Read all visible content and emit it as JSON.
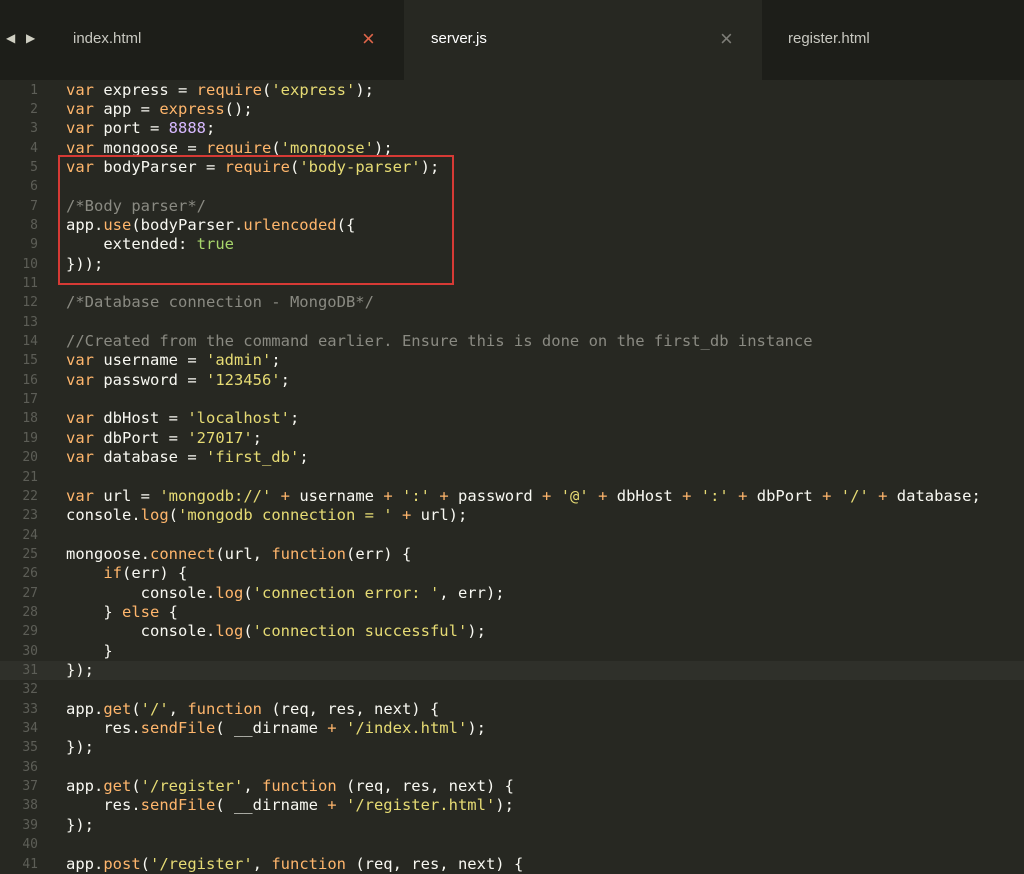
{
  "tabs": [
    {
      "label": "index.html",
      "close_icon": "×",
      "active": false
    },
    {
      "label": "server.js",
      "close_icon": "×",
      "active": true
    },
    {
      "label": "register.html",
      "active": false
    }
  ],
  "nav": {
    "back": "◀",
    "forward": "▶"
  },
  "colors": {
    "keyword": "#ffb66c",
    "string": "#e6db74",
    "comment": "#8a8a82",
    "number": "#d7b9ff",
    "highlight_box": "#d63a35"
  },
  "editor": {
    "current_line": 31,
    "lines": [
      [
        [
          "kw",
          "var"
        ],
        [
          "p",
          " express = "
        ],
        [
          "kw",
          "require"
        ],
        [
          "p",
          "("
        ],
        [
          "st",
          "'express'"
        ],
        [
          "p",
          ");"
        ]
      ],
      [
        [
          "kw",
          "var"
        ],
        [
          "p",
          " app = "
        ],
        [
          "kw",
          "express"
        ],
        [
          "p",
          "();"
        ]
      ],
      [
        [
          "kw",
          "var"
        ],
        [
          "p",
          " port = "
        ],
        [
          "nu",
          "8888"
        ],
        [
          "p",
          ";"
        ]
      ],
      [
        [
          "kw",
          "var"
        ],
        [
          "p",
          " mongoose = "
        ],
        [
          "kw",
          "require"
        ],
        [
          "p",
          "("
        ],
        [
          "st",
          "'mongoose'"
        ],
        [
          "p",
          ");"
        ]
      ],
      [
        [
          "kw",
          "var"
        ],
        [
          "p",
          " bodyParser = "
        ],
        [
          "kw",
          "require"
        ],
        [
          "p",
          "("
        ],
        [
          "st",
          "'body-parser'"
        ],
        [
          "p",
          ");"
        ]
      ],
      [],
      [
        [
          "cm",
          "/*Body parser*/"
        ]
      ],
      [
        [
          "p",
          "app."
        ],
        [
          "kw",
          "use"
        ],
        [
          "p",
          "(bodyParser."
        ],
        [
          "kw",
          "urlencoded"
        ],
        [
          "p",
          "({"
        ]
      ],
      [
        [
          "p",
          "    extended: "
        ],
        [
          "kv",
          "true"
        ]
      ],
      [
        [
          "p",
          "}));"
        ]
      ],
      [],
      [
        [
          "cm",
          "/*Database connection - MongoDB*/"
        ]
      ],
      [],
      [
        [
          "cm",
          "//Created from the command earlier. Ensure this is done on the first_db instance"
        ]
      ],
      [
        [
          "kw",
          "var"
        ],
        [
          "p",
          " username = "
        ],
        [
          "st",
          "'admin'"
        ],
        [
          "p",
          ";"
        ]
      ],
      [
        [
          "kw",
          "var"
        ],
        [
          "p",
          " password = "
        ],
        [
          "st",
          "'123456'"
        ],
        [
          "p",
          ";"
        ]
      ],
      [],
      [
        [
          "kw",
          "var"
        ],
        [
          "p",
          " dbHost = "
        ],
        [
          "st",
          "'localhost'"
        ],
        [
          "p",
          ";"
        ]
      ],
      [
        [
          "kw",
          "var"
        ],
        [
          "p",
          " dbPort = "
        ],
        [
          "st",
          "'27017'"
        ],
        [
          "p",
          ";"
        ]
      ],
      [
        [
          "kw",
          "var"
        ],
        [
          "p",
          " database = "
        ],
        [
          "st",
          "'first_db'"
        ],
        [
          "p",
          ";"
        ]
      ],
      [],
      [
        [
          "kw",
          "var"
        ],
        [
          "p",
          " url = "
        ],
        [
          "st",
          "'mongodb://'"
        ],
        [
          "p",
          " "
        ],
        [
          "kw",
          "+"
        ],
        [
          "p",
          " username "
        ],
        [
          "kw",
          "+"
        ],
        [
          "p",
          " "
        ],
        [
          "st",
          "':'"
        ],
        [
          "p",
          " "
        ],
        [
          "kw",
          "+"
        ],
        [
          "p",
          " password "
        ],
        [
          "kw",
          "+"
        ],
        [
          "p",
          " "
        ],
        [
          "st",
          "'@'"
        ],
        [
          "p",
          " "
        ],
        [
          "kw",
          "+"
        ],
        [
          "p",
          " dbHost "
        ],
        [
          "kw",
          "+"
        ],
        [
          "p",
          " "
        ],
        [
          "st",
          "':'"
        ],
        [
          "p",
          " "
        ],
        [
          "kw",
          "+"
        ],
        [
          "p",
          " dbPort "
        ],
        [
          "kw",
          "+"
        ],
        [
          "p",
          " "
        ],
        [
          "st",
          "'/'"
        ],
        [
          "p",
          " "
        ],
        [
          "kw",
          "+"
        ],
        [
          "p",
          " database;"
        ]
      ],
      [
        [
          "p",
          "console."
        ],
        [
          "kw",
          "log"
        ],
        [
          "p",
          "("
        ],
        [
          "st",
          "'mongodb connection = '"
        ],
        [
          "p",
          " "
        ],
        [
          "kw",
          "+"
        ],
        [
          "p",
          " url);"
        ]
      ],
      [],
      [
        [
          "p",
          "mongoose."
        ],
        [
          "kw",
          "connect"
        ],
        [
          "p",
          "(url, "
        ],
        [
          "kw",
          "function"
        ],
        [
          "p",
          "(err) {"
        ]
      ],
      [
        [
          "p",
          "    "
        ],
        [
          "kw",
          "if"
        ],
        [
          "p",
          "(err) {"
        ]
      ],
      [
        [
          "p",
          "        console."
        ],
        [
          "kw",
          "log"
        ],
        [
          "p",
          "("
        ],
        [
          "st",
          "'connection error: '"
        ],
        [
          "p",
          ", err);"
        ]
      ],
      [
        [
          "p",
          "    } "
        ],
        [
          "kw",
          "else"
        ],
        [
          "p",
          " {"
        ]
      ],
      [
        [
          "p",
          "        console."
        ],
        [
          "kw",
          "log"
        ],
        [
          "p",
          "("
        ],
        [
          "st",
          "'connection successful'"
        ],
        [
          "p",
          ");"
        ]
      ],
      [
        [
          "p",
          "    }"
        ]
      ],
      [
        [
          "p",
          "});"
        ]
      ],
      [],
      [
        [
          "p",
          "app."
        ],
        [
          "kw",
          "get"
        ],
        [
          "p",
          "("
        ],
        [
          "st",
          "'/'"
        ],
        [
          "p",
          ", "
        ],
        [
          "kw",
          "function"
        ],
        [
          "p",
          " (req, res, next) {"
        ]
      ],
      [
        [
          "p",
          "    res."
        ],
        [
          "kw",
          "sendFile"
        ],
        [
          "p",
          "( __dirname "
        ],
        [
          "kw",
          "+"
        ],
        [
          "p",
          " "
        ],
        [
          "st",
          "'/index.html'"
        ],
        [
          "p",
          ");"
        ]
      ],
      [
        [
          "p",
          "});"
        ]
      ],
      [],
      [
        [
          "p",
          "app."
        ],
        [
          "kw",
          "get"
        ],
        [
          "p",
          "("
        ],
        [
          "st",
          "'/register'"
        ],
        [
          "p",
          ", "
        ],
        [
          "kw",
          "function"
        ],
        [
          "p",
          " (req, res, next) {"
        ]
      ],
      [
        [
          "p",
          "    res."
        ],
        [
          "kw",
          "sendFile"
        ],
        [
          "p",
          "( __dirname "
        ],
        [
          "kw",
          "+"
        ],
        [
          "p",
          " "
        ],
        [
          "st",
          "'/register.html'"
        ],
        [
          "p",
          ");"
        ]
      ],
      [
        [
          "p",
          "});"
        ]
      ],
      [],
      [
        [
          "p",
          "app."
        ],
        [
          "kw",
          "post"
        ],
        [
          "p",
          "("
        ],
        [
          "st",
          "'/register'"
        ],
        [
          "p",
          ", "
        ],
        [
          "kw",
          "function"
        ],
        [
          "p",
          " (req, res, next) {"
        ]
      ]
    ]
  }
}
